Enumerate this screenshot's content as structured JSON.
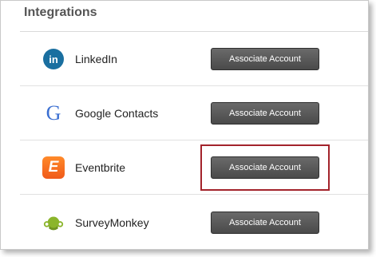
{
  "section": {
    "title": "Integrations"
  },
  "integrations": [
    {
      "name": "LinkedIn",
      "icon": "linkedin-icon",
      "icon_text": "in",
      "button_label": "Associate Account"
    },
    {
      "name": "Google Contacts",
      "icon": "google-icon",
      "icon_text": "G",
      "button_label": "Associate Account"
    },
    {
      "name": "Eventbrite",
      "icon": "eventbrite-icon",
      "icon_text": "E",
      "button_label": "Associate Account"
    },
    {
      "name": "SurveyMonkey",
      "icon": "surveymonkey-icon",
      "button_label": "Associate Account"
    }
  ],
  "colors": {
    "button": "#555555",
    "highlight": "#a3232b",
    "linkedin": "#1a6fa0",
    "google": "#3b6fd1",
    "eventbrite": "#f26b21",
    "surveymonkey": "#8bb52b"
  }
}
